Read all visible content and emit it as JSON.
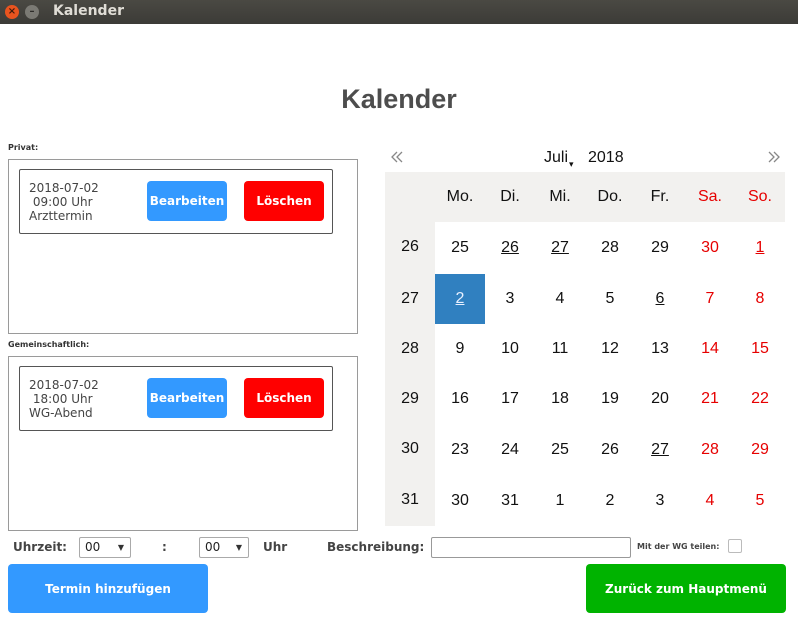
{
  "window": {
    "title": "Kalender"
  },
  "page_title": "Kalender",
  "private_section": {
    "label": "Privat:",
    "appointments": [
      {
        "text": "2018-07-02\n 09:00 Uhr\nArzttermin",
        "edit_label": "Bearbeiten",
        "delete_label": "Löschen"
      }
    ]
  },
  "shared_section": {
    "label": "Gemeinschaftlich:",
    "appointments": [
      {
        "text": "2018-07-02\n 18:00 Uhr\nWG-Abend",
        "edit_label": "Bearbeiten",
        "delete_label": "Löschen"
      }
    ]
  },
  "calendar": {
    "month": "Juli",
    "year": "2018",
    "weekdays": [
      "Mo.",
      "Di.",
      "Mi.",
      "Do.",
      "Fr.",
      "Sa.",
      "So."
    ],
    "weeks": [
      {
        "week": "26",
        "days": [
          "25",
          "26",
          "27",
          "28",
          "29",
          "30",
          "1"
        ]
      },
      {
        "week": "27",
        "days": [
          "2",
          "3",
          "4",
          "5",
          "6",
          "7",
          "8"
        ]
      },
      {
        "week": "28",
        "days": [
          "9",
          "10",
          "11",
          "12",
          "13",
          "14",
          "15"
        ]
      },
      {
        "week": "29",
        "days": [
          "16",
          "17",
          "18",
          "19",
          "20",
          "21",
          "22"
        ]
      },
      {
        "week": "30",
        "days": [
          "23",
          "24",
          "25",
          "26",
          "27",
          "28",
          "29"
        ]
      },
      {
        "week": "31",
        "days": [
          "30",
          "31",
          "1",
          "2",
          "3",
          "4",
          "5"
        ]
      }
    ],
    "selected": [
      1,
      0
    ],
    "marked": [
      [
        0,
        1
      ],
      [
        0,
        2
      ],
      [
        0,
        6
      ],
      [
        1,
        0
      ],
      [
        1,
        4
      ],
      [
        4,
        4
      ]
    ],
    "colors": {
      "weekend": "#e60000",
      "selected_bg": "#3080c0",
      "header_bg": "#f2f1ef"
    }
  },
  "form": {
    "time_label": "Uhrzeit:",
    "hour_value": "00",
    "separator": ":",
    "minute_value": "00",
    "unit_label": "Uhr",
    "description_label": "Beschreibung:",
    "description_value": "",
    "share_label": "Mit der WG teilen:",
    "share_checked": false
  },
  "buttons": {
    "add_label": "Termin hinzufügen",
    "back_label": "Zurück zum Hauptmenü"
  },
  "colors": {
    "blue": "#3399ff",
    "red": "#ff0000",
    "green": "#00b300"
  }
}
